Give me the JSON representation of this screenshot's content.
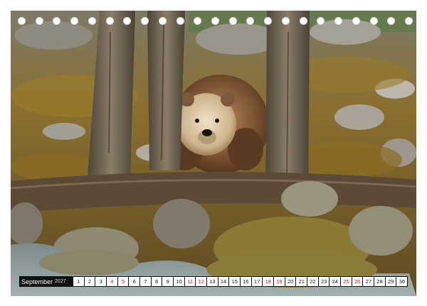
{
  "calendar": {
    "month": "September",
    "year": "2027",
    "days": [
      {
        "n": "1",
        "weekend": false
      },
      {
        "n": "2",
        "weekend": false
      },
      {
        "n": "3",
        "weekend": false
      },
      {
        "n": "4",
        "weekend": true
      },
      {
        "n": "5",
        "weekend": true
      },
      {
        "n": "6",
        "weekend": false
      },
      {
        "n": "7",
        "weekend": false
      },
      {
        "n": "8",
        "weekend": false
      },
      {
        "n": "9",
        "weekend": false
      },
      {
        "n": "10",
        "weekend": false
      },
      {
        "n": "11",
        "weekend": true
      },
      {
        "n": "12",
        "weekend": true
      },
      {
        "n": "13",
        "weekend": false
      },
      {
        "n": "14",
        "weekend": false
      },
      {
        "n": "15",
        "weekend": false
      },
      {
        "n": "16",
        "weekend": false
      },
      {
        "n": "17",
        "weekend": false
      },
      {
        "n": "18",
        "weekend": true
      },
      {
        "n": "19",
        "weekend": true
      },
      {
        "n": "20",
        "weekend": false
      },
      {
        "n": "21",
        "weekend": false
      },
      {
        "n": "22",
        "weekend": false
      },
      {
        "n": "23",
        "weekend": false
      },
      {
        "n": "24",
        "weekend": false
      },
      {
        "n": "25",
        "weekend": true
      },
      {
        "n": "26",
        "weekend": true
      },
      {
        "n": "27",
        "weekend": false
      },
      {
        "n": "28",
        "weekend": false
      },
      {
        "n": "29",
        "weekend": false
      },
      {
        "n": "30",
        "weekend": false
      }
    ]
  },
  "binding_holes": 23,
  "colors": {
    "weekday": "#111111",
    "weekend": "#d11a1a",
    "bar": "#111111"
  }
}
